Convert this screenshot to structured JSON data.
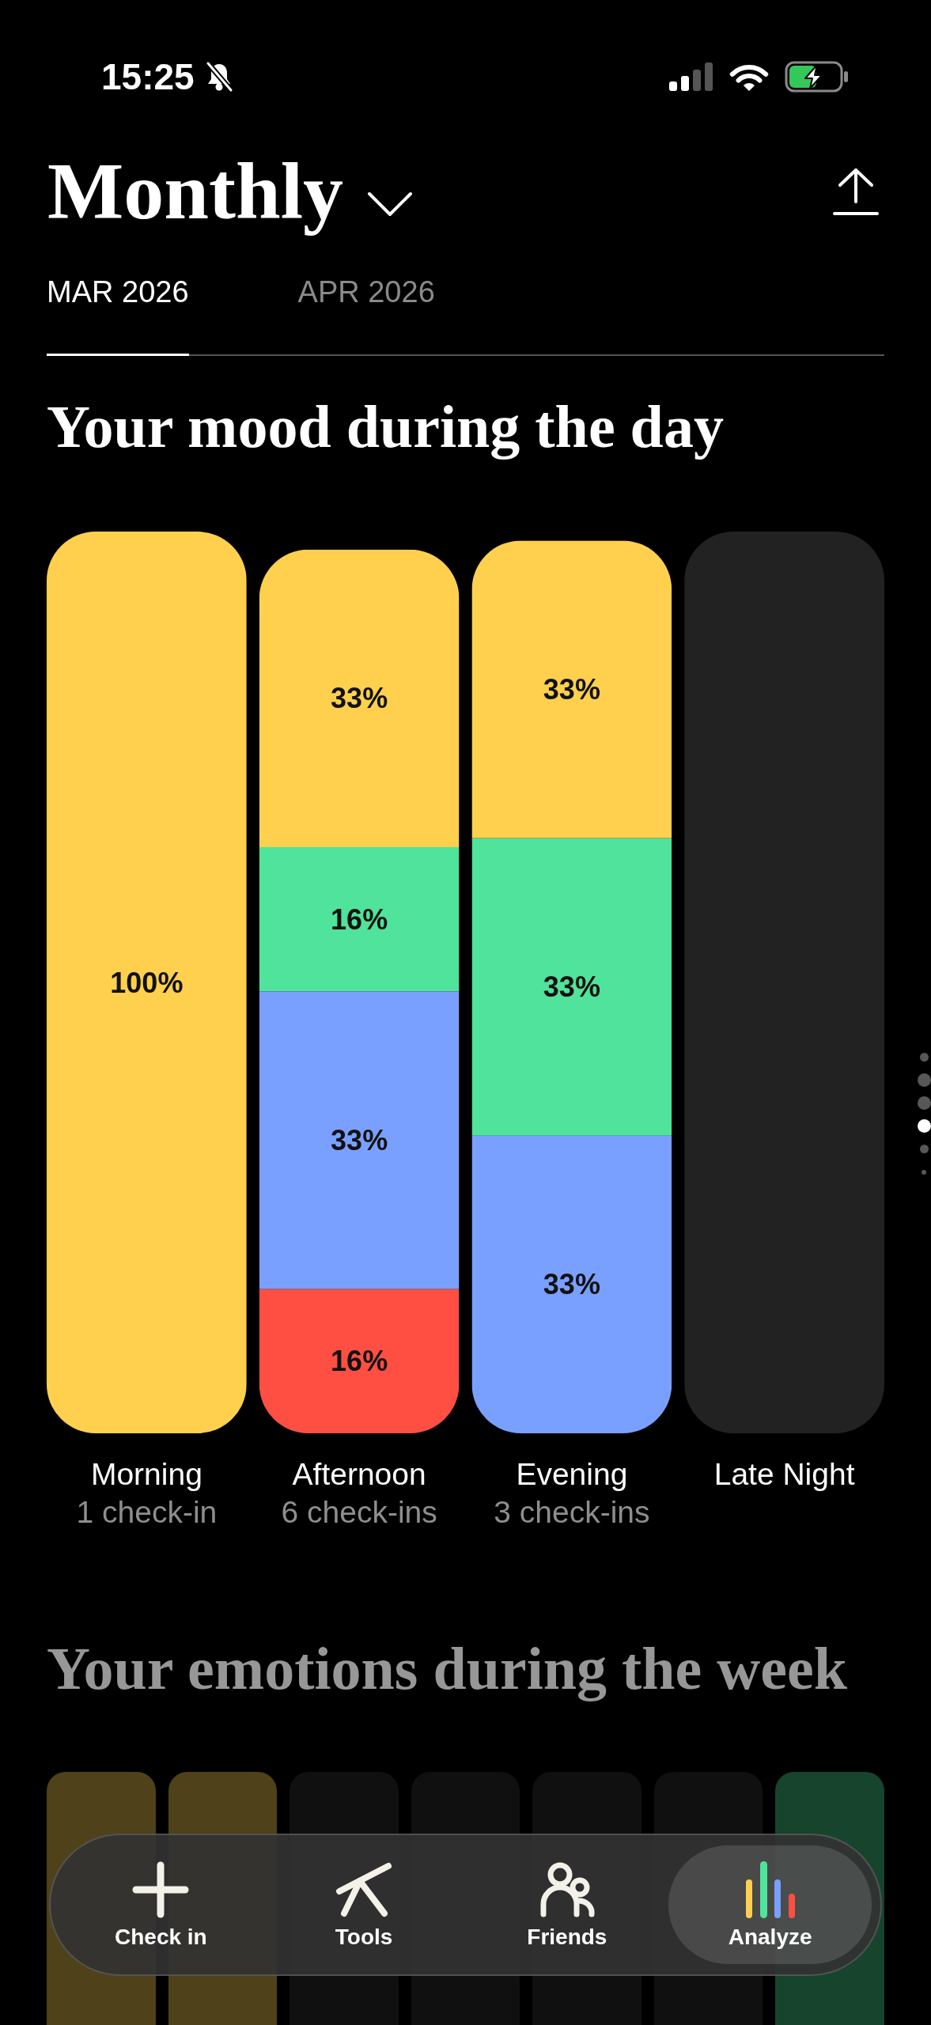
{
  "status_bar": {
    "time": "15:25"
  },
  "header": {
    "title": "Monthly",
    "tabs": [
      {
        "label": "MAR 2026",
        "selected": true
      },
      {
        "label": "APR 2026",
        "selected": false
      }
    ]
  },
  "mood_section": {
    "title": "Your mood during the day",
    "chart_data": {
      "type": "bar",
      "stacked": true,
      "categories": [
        "Morning",
        "Afternoon",
        "Evening",
        "Late Night"
      ],
      "series": [
        {
          "color": "#ff4f42",
          "values": [
            null,
            16,
            null,
            null
          ],
          "value_labels": [
            null,
            "16%",
            null,
            null
          ]
        },
        {
          "color": "#7aa0ff",
          "values": [
            null,
            33,
            33,
            null
          ],
          "value_labels": [
            null,
            "33%",
            "33%",
            null
          ]
        },
        {
          "color": "#4fe39b",
          "values": [
            null,
            16,
            33,
            null
          ],
          "value_labels": [
            null,
            "16%",
            "33%",
            null
          ]
        },
        {
          "color": "#ffd04d",
          "values": [
            100,
            33,
            33,
            null
          ],
          "value_labels": [
            "100%",
            "33%",
            "33%",
            null
          ]
        }
      ],
      "bands": [
        {
          "axis": "x",
          "from": "Late Night",
          "to": "Late Night",
          "color": "#222222"
        }
      ]
    },
    "counts": [
      "1 check-in",
      "6 check-ins",
      "3 check-ins"
    ]
  },
  "week_section": {
    "title": "Your emotions during the week",
    "days": [
      {
        "color": "#4f411a"
      },
      {
        "color": "#4f411a"
      },
      {
        "color": "#101010"
      },
      {
        "color": "#101010"
      },
      {
        "color": "#101010"
      },
      {
        "color": "#101010"
      },
      {
        "color": "#17442d"
      }
    ]
  },
  "page_dots": [
    {
      "selected": false
    },
    {
      "selected": false
    },
    {
      "selected": false
    },
    {
      "selected": true
    },
    {
      "selected": false
    },
    {
      "selected": false
    }
  ],
  "tab_bar": {
    "items": [
      {
        "label": "Check in",
        "selected": false
      },
      {
        "label": "Tools",
        "selected": false
      },
      {
        "label": "Friends",
        "selected": false
      },
      {
        "label": "Analyze",
        "selected": true
      }
    ]
  }
}
